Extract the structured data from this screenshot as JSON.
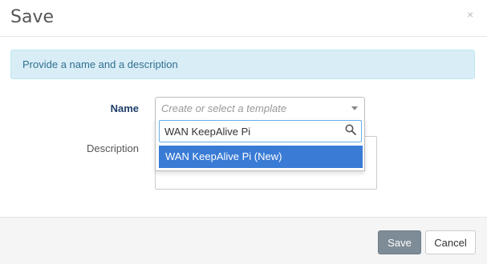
{
  "dialog": {
    "title": "Save",
    "close_glyph": "×"
  },
  "alert": {
    "text": "Provide a name and a description"
  },
  "form": {
    "name_label": "Name",
    "description_label": "Description",
    "name_select": {
      "placeholder": "Create or select a template",
      "search_value": "WAN KeepAlive Pi",
      "options": [
        {
          "label": "WAN KeepAlive Pi (New)",
          "highlighted": true
        }
      ]
    },
    "description_value": ""
  },
  "footer": {
    "save_label": "Save",
    "cancel_label": "Cancel"
  },
  "colors": {
    "alert_bg": "#d9edf7",
    "alert_text": "#31708f",
    "highlight": "#3a7bd5",
    "save_button": "#7d8c96",
    "label_name": "#1f3f6b"
  },
  "icons": {
    "close": "close-icon",
    "search": "search-icon",
    "caret": "chevron-down-icon"
  }
}
